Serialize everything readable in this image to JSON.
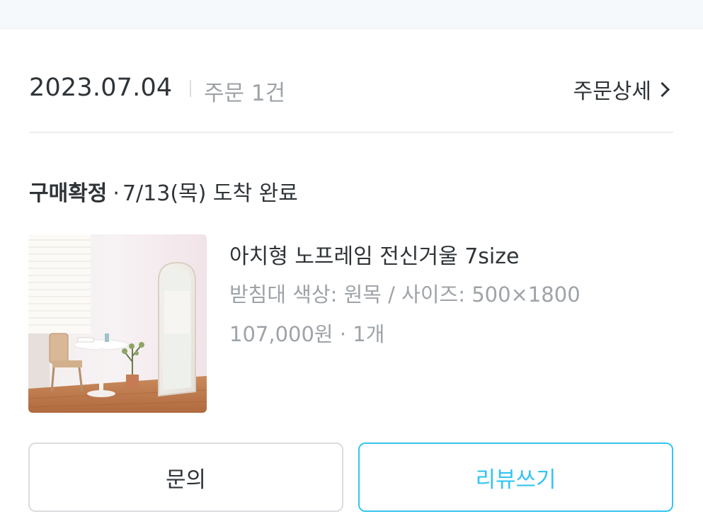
{
  "colors": {
    "text_primary": "#2f3438",
    "text_secondary": "#9ea3a8",
    "accent": "#35c5f0",
    "border": "#dadce0",
    "top_band": "#f6f9fc"
  },
  "order": {
    "date": "2023.07.04",
    "count_label": "주문 1건",
    "detail_link_label": "주문상세"
  },
  "shipment": {
    "status": "구매확정",
    "separator": "·",
    "arrival_text": "7/13(목) 도착 완료"
  },
  "product": {
    "thumbnail_icon": "product-photo",
    "title": "아치형 노프레임 전신거울 7size",
    "option": "받침대 색상: 원목 / 사이즈: 500×1800",
    "price_qty": "107,000원 · 1개"
  },
  "actions": {
    "inquiry_label": "문의",
    "review_label": "리뷰쓰기"
  }
}
